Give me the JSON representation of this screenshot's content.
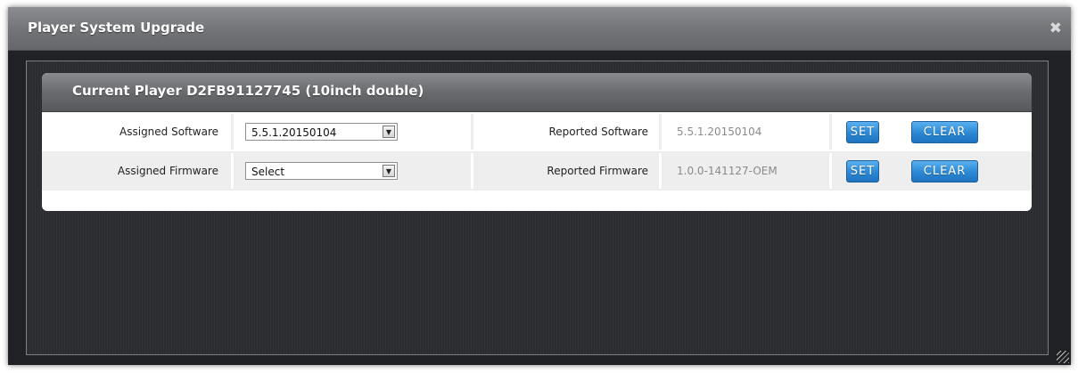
{
  "dialog": {
    "title": "Player System Upgrade",
    "close_icon": "close-icon"
  },
  "panel": {
    "title": "Current Player D2FB91127745 (10inch double)"
  },
  "rows": [
    {
      "assigned_label": "Assigned Software",
      "assigned_value": "5.5.1.20150104",
      "reported_label": "Reported Software",
      "reported_value": "5.5.1.20150104",
      "set_label": "SET",
      "clear_label": "CLEAR"
    },
    {
      "assigned_label": "Assigned Firmware",
      "assigned_value": "Select",
      "reported_label": "Reported Firmware",
      "reported_value": "1.0.0-141127-OEM",
      "set_label": "SET",
      "clear_label": "CLEAR"
    }
  ],
  "colors": {
    "titlebar": "#727376",
    "button": "#2b88d4",
    "background": "#1f2124"
  }
}
